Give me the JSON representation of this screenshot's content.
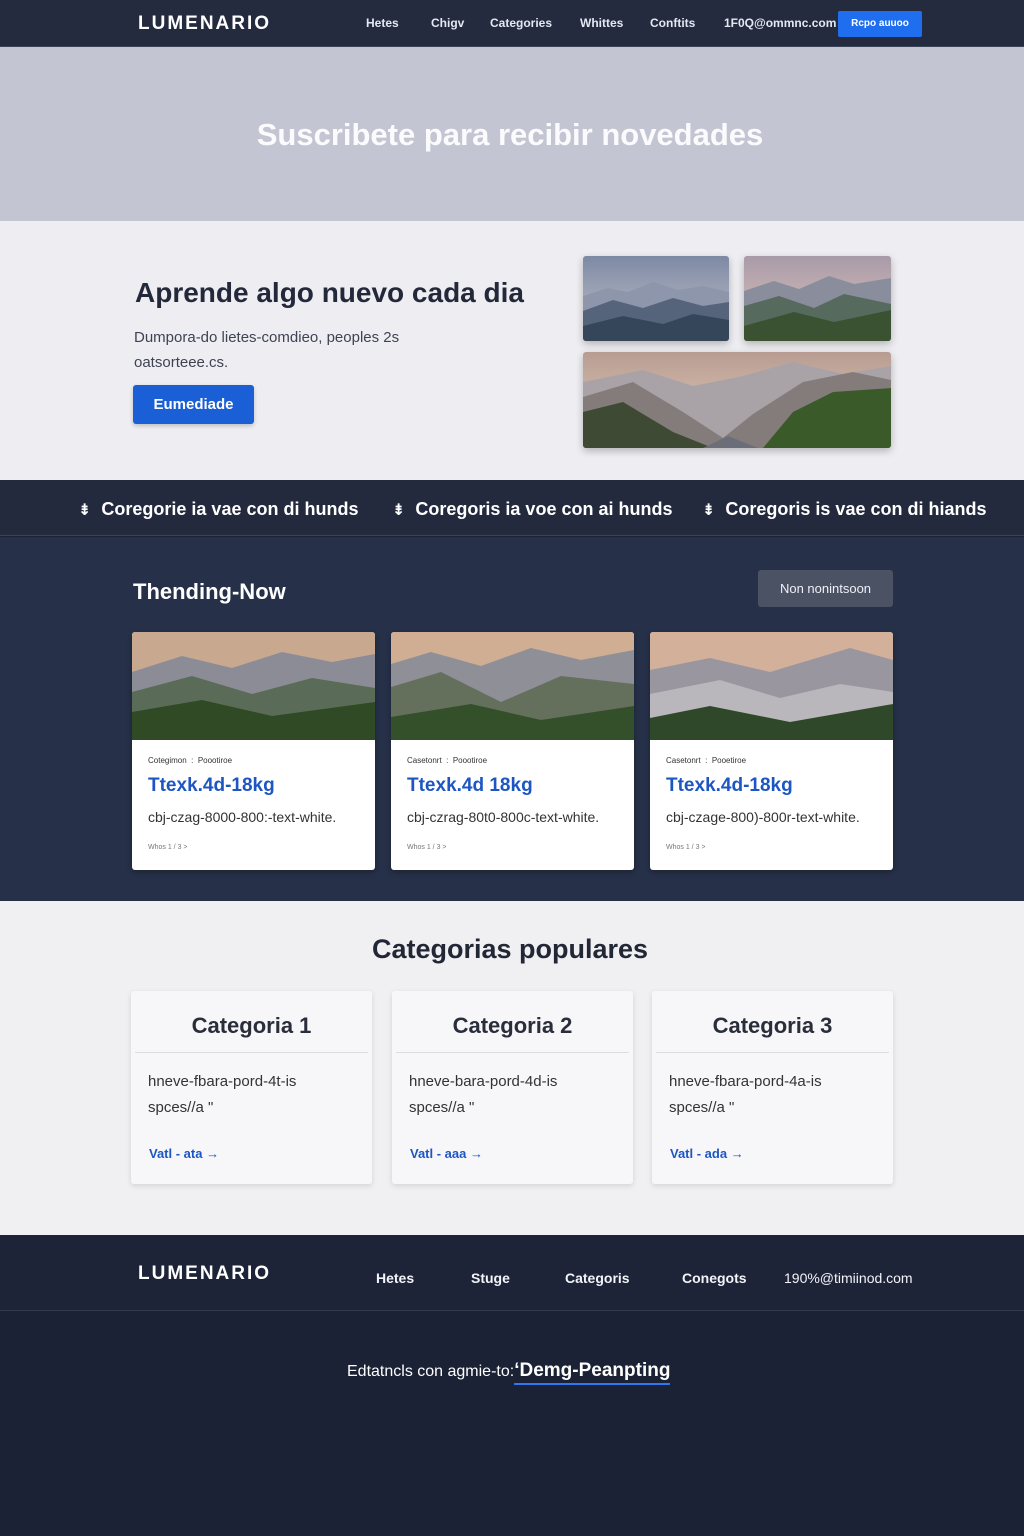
{
  "header": {
    "logo": "LUMENARIO",
    "nav": [
      "Hetes",
      "Chigv",
      "Categories",
      "Whittes",
      "Conftits",
      "1F0Q@ommnc.com"
    ],
    "cta": "Rcpo auuoo"
  },
  "hero": {
    "title": "Suscribete para recibir novedades"
  },
  "learn": {
    "title": "Aprende algo nuevo cada dia",
    "text": "Dumpora-do lietes-comdieo, peoples 2s oatsorteee.cs.",
    "button": "Eumediade"
  },
  "band": {
    "items": [
      "Coregorie ia vae con di hunds",
      "Coregoris ia voe con ai hunds",
      "Coregoris is vae con di hiands"
    ]
  },
  "trending": {
    "title": "Thending-Now",
    "button": "Non nonintsoon",
    "cards": [
      {
        "category": "Cotegimon",
        "tag": "Poootiroe",
        "title": "Ttexk.4d-18kg",
        "desc": "cbj-czag-8000-800:-text-white.",
        "footer": "Whos 1 / 3 >"
      },
      {
        "category": "Casetonrt",
        "tag": "Poootiroe",
        "title": "Ttexk.4d 18kg",
        "desc": "cbj-czrag-80t0-800c-text-white.",
        "footer": "Whos 1 / 3 >"
      },
      {
        "category": "Casetonrt",
        "tag": "Pooetiroe",
        "title": "Ttexk.4d-18kg",
        "desc": "cbj-czage-800)-800r-text-white.",
        "footer": "Whos 1 / 3 >"
      }
    ]
  },
  "categories": {
    "title": "Categorias populares",
    "items": [
      {
        "name": "Categoria 1",
        "desc": "hneve-fbara-pord-4t-is spces//a \"",
        "link": "Vatl - ata →"
      },
      {
        "name": "Categoria 2",
        "desc": "hneve-bara-pord-4d-is spces//a \"",
        "link": "Vatl - aaa →"
      },
      {
        "name": "Categoria 3",
        "desc": "hneve-fbara-pord-4a-is spces//a \"",
        "link": "Vatl - ada →"
      }
    ]
  },
  "footer": {
    "logo": "LUMENARIO",
    "links": [
      "Hetes",
      "Stuge",
      "Categoris",
      "Conegots",
      "190%@timiinod.com"
    ],
    "note": "Edtatncls con agmie-to:",
    "note_link": "‘Demg-Peanpting"
  },
  "colors": {
    "accent": "#1f6ef0",
    "link": "#1d56c2",
    "dark": "#1d2437"
  },
  "icons": [
    "arrow-icon",
    "move-icon"
  ]
}
